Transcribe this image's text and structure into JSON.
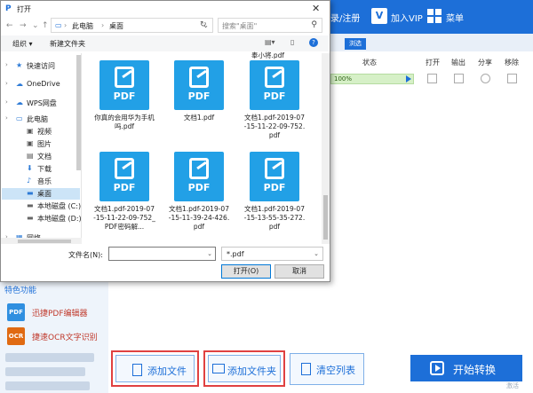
{
  "app": {
    "header_login": "录/注册",
    "vip_label": "加入VIP",
    "menu_label": "菜单",
    "browse_label": "浏选",
    "columns": {
      "status": "状态",
      "open": "打开",
      "output": "输出",
      "share": "分享",
      "remove": "移除"
    },
    "file_row": {
      "progress_text": "100%",
      "progress": 1.0
    },
    "features_title": "特色功能",
    "features": [
      {
        "label": "迅捷PDF编辑器",
        "icon": "pdf-editor-icon",
        "icon_text": "PDF",
        "color": "#2f8fe0"
      },
      {
        "label": "捷速OCR文字识别",
        "icon": "ocr-icon",
        "icon_text": "OCR",
        "color": "#e06a12"
      }
    ],
    "add_file_label": "添加文件",
    "add_folder_label": "添加文件夹",
    "clear_list_label": "清空列表",
    "start_label": "开始转换",
    "watermark": "激活"
  },
  "dialog": {
    "title": "打开",
    "close": "✕",
    "breadcrumb": [
      "此电脑",
      "桌面"
    ],
    "search_placeholder": "搜索\"桌面\"",
    "organize_label": "组织 ▾",
    "new_folder_label": "新建文件夹",
    "nav": [
      {
        "label": "快速访问",
        "icon": "star-icon",
        "glyph": "★",
        "color": "#2e7bd6"
      },
      {
        "label": "OneDrive",
        "icon": "cloud-icon",
        "glyph": "☁",
        "color": "#2e7bd6"
      },
      {
        "label": "WPS网盘",
        "icon": "cloud-icon",
        "glyph": "☁",
        "color": "#2e7bd6"
      },
      {
        "label": "此电脑",
        "icon": "computer-icon",
        "glyph": "▭",
        "color": "#2e7bd6"
      },
      {
        "label": "视频",
        "icon": "video-icon",
        "glyph": "▣",
        "color": "#555"
      },
      {
        "label": "图片",
        "icon": "pictures-icon",
        "glyph": "▣",
        "color": "#555"
      },
      {
        "label": "文档",
        "icon": "documents-icon",
        "glyph": "▤",
        "color": "#555"
      },
      {
        "label": "下载",
        "icon": "download-icon",
        "glyph": "⬇",
        "color": "#2e7bd6"
      },
      {
        "label": "音乐",
        "icon": "music-icon",
        "glyph": "♪",
        "color": "#2e7bd6"
      },
      {
        "label": "桌面",
        "icon": "desktop-icon",
        "glyph": "▬",
        "color": "#2e7bd6"
      },
      {
        "label": "本地磁盘 (C:)",
        "icon": "drive-icon",
        "glyph": "▬",
        "color": "#666"
      },
      {
        "label": "本地磁盘 (D:)",
        "icon": "drive-icon",
        "glyph": "▬",
        "color": "#666"
      },
      {
        "label": "网络",
        "icon": "network-icon",
        "glyph": "▦",
        "color": "#2e7bd6"
      }
    ],
    "top_partial_name": "奉小将.pdf",
    "files": [
      {
        "name": "你真的会用华为手机吗.pdf"
      },
      {
        "name": "文档1.pdf"
      },
      {
        "name": "文档1.pdf-2019-07-15-11-22-09-752.pdf"
      },
      {
        "name": "文档1.pdf-2019-07-15-11-22-09-752_PDF密码解..."
      },
      {
        "name": "文档1.pdf-2019-07-15-11-39-24-426.pdf"
      },
      {
        "name": "文档1.pdf-2019-07-15-13-55-35-272.pdf"
      }
    ],
    "pdf_tile_text": "PDF",
    "filename_label": "文件名(N):",
    "filename_value": "",
    "filetype_value": "*.pdf",
    "open_label": "打开(O)",
    "cancel_label": "取消"
  }
}
